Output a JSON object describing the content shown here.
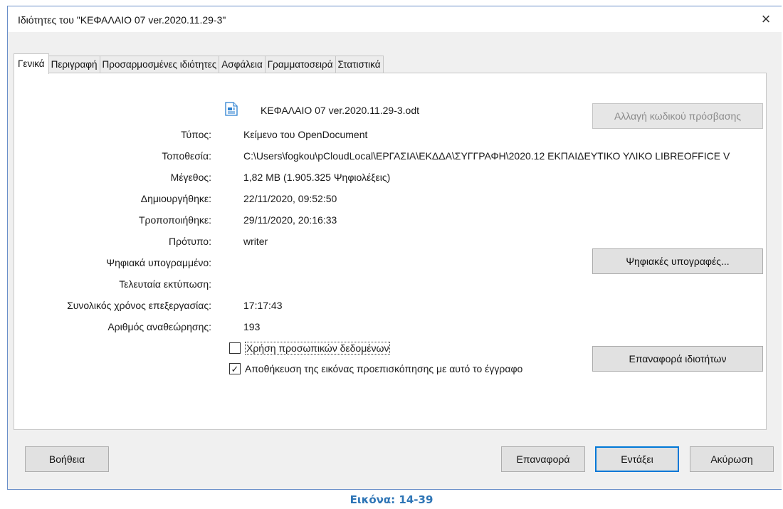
{
  "dialog": {
    "title": "Ιδιότητες του \"ΚΕΦΑΛΑΙΟ 07 ver.2020.11.29-3\"",
    "close_glyph": "×"
  },
  "tabs": [
    {
      "label": "Γενικά",
      "active": true
    },
    {
      "label": "Περιγραφή",
      "active": false
    },
    {
      "label": "Προσαρμοσμένες ιδιότητες",
      "active": false
    },
    {
      "label": "Ασφάλεια",
      "active": false
    },
    {
      "label": "Γραμματοσειρά",
      "active": false
    },
    {
      "label": "Στατιστικά",
      "active": false
    }
  ],
  "general": {
    "file_icon": "writer-document-icon",
    "file_name": "ΚΕΦΑΛΑΙΟ 07 ver.2020.11.29-3.odt",
    "change_password_button": "Αλλαγή κωδικού πρόσβασης",
    "fields": [
      {
        "label": "Τύπος:",
        "value": "Κείμενο του OpenDocument"
      },
      {
        "label": "Τοποθεσία:",
        "value": "C:\\Users\\fogkou\\pCloudLocal\\ΕΡΓΑΣΙΑ\\ΕΚΔΔΑ\\ΣΥΓΓΡΑΦΗ\\2020.12 ΕΚΠΑΙΔΕΥΤΙΚΟ ΥΛΙΚΟ LIBREOFFICE V"
      },
      {
        "label": "Μέγεθος:",
        "value": "1,82 MB (1.905.325 Ψηφιολέξεις)"
      },
      {
        "label": "Δημιουργήθηκε:",
        "value": "22/11/2020, 09:52:50"
      },
      {
        "label": "Τροποποιήθηκε:",
        "value": "29/11/2020, 20:16:33"
      },
      {
        "label": "Πρότυπο:",
        "value": "writer"
      },
      {
        "label": "Ψηφιακά υπογραμμένο:",
        "value": ""
      },
      {
        "label": "Τελευταία εκτύπωση:",
        "value": ""
      },
      {
        "label": "Συνολικός χρόνος επεξεργασίας:",
        "value": "17:17:43"
      },
      {
        "label": "Αριθμός αναθεώρησης:",
        "value": "193"
      }
    ],
    "digital_signatures_button": "Ψηφιακές υπογραφές...",
    "use_user_data_checkbox": {
      "label": "Χρήση προσωπικών δεδομένων",
      "checked": false
    },
    "save_preview_checkbox": {
      "label": "Αποθήκευση της εικόνας προεπισκόπησης με αυτό το έγγραφο",
      "checked": true
    },
    "reset_properties_button": "Επαναφορά ιδιοτήτων"
  },
  "footer": {
    "help_button": "Βοήθεια",
    "reset_button": "Επαναφορά",
    "ok_button": "Εντάξει",
    "cancel_button": "Ακύρωση"
  },
  "caption": "Εικόνα: 14-39",
  "colors": {
    "accent": "#0078d7",
    "caption": "#2e75b6"
  }
}
